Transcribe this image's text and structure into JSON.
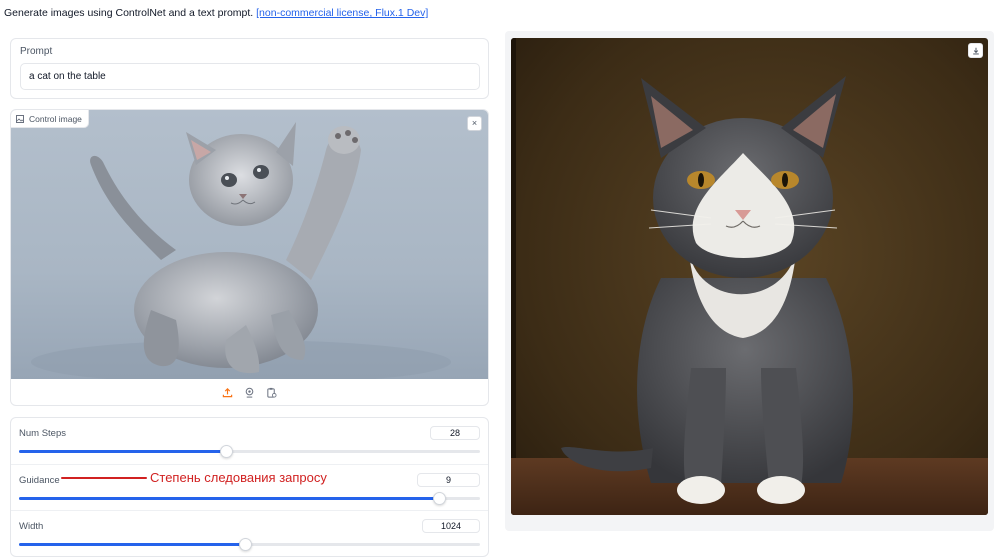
{
  "intro": {
    "text": "Generate images using ControlNet and a text prompt.",
    "link": "[non-commercial license, Flux.1 Dev]"
  },
  "prompt": {
    "label": "Prompt",
    "value": "a cat on the table"
  },
  "control_image": {
    "label": "Control image",
    "close": "×",
    "tools": [
      "upload-icon",
      "webcam-icon",
      "clipboard-icon"
    ]
  },
  "sliders": [
    {
      "label": "Num Steps",
      "value": "28",
      "fraction": 0.45
    },
    {
      "label": "Guidance",
      "value": "9",
      "fraction": 0.91,
      "annotation": "Степень следования запросу"
    },
    {
      "label": "Width",
      "value": "1024",
      "fraction": 0.49
    }
  ],
  "colors": {
    "accent": "#2563eb",
    "annotation": "#d12121"
  },
  "output": {
    "download_icon": "download-icon"
  }
}
